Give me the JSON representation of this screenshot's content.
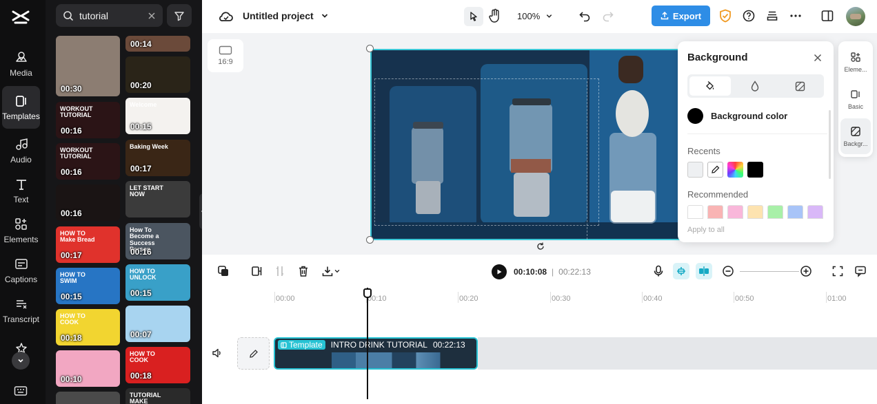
{
  "sidebar": {
    "items": [
      {
        "label": "Media",
        "icon": "media-icon"
      },
      {
        "label": "Templates",
        "icon": "templates-icon"
      },
      {
        "label": "Audio",
        "icon": "audio-icon"
      },
      {
        "label": "Text",
        "icon": "text-icon"
      },
      {
        "label": "Elements",
        "icon": "elements-icon"
      },
      {
        "label": "Captions",
        "icon": "captions-icon"
      },
      {
        "label": "Transcript",
        "icon": "transcript-icon"
      },
      {
        "label": "",
        "icon": "effects-icon"
      }
    ]
  },
  "search": {
    "value": "tutorial"
  },
  "templates": [
    {
      "duration": "00:30",
      "caption": "",
      "color": "#8c7d72"
    },
    {
      "duration": "00:14",
      "caption": "",
      "color": "#6b4a3a"
    },
    {
      "duration": "00:20",
      "caption": "",
      "color": "#2a2418"
    },
    {
      "duration": "00:16",
      "caption": "WORKOUT TUTORIAL",
      "color": "#2b1416"
    },
    {
      "duration": "00:15",
      "caption": "Welcome",
      "color": "#f4f2ef"
    },
    {
      "duration": "00:16",
      "caption": "WORKOUT TUTORIAL",
      "color": "#2b1416"
    },
    {
      "duration": "00:17",
      "caption": "Baking Week",
      "color": "#3a2616"
    },
    {
      "duration": "00:16",
      "caption": "",
      "color": "#1a1414"
    },
    {
      "duration": "",
      "caption": "LET START NOW",
      "color": "#3b3b3b"
    },
    {
      "duration": "00:17",
      "caption": "HOW TO Make Bread",
      "color": "#e0322c"
    },
    {
      "duration": "00:16",
      "caption": "How To Become a Success Person",
      "color": "#4b5560"
    },
    {
      "duration": "00:15",
      "caption": "HOW TO SWIM",
      "color": "#2775c4"
    },
    {
      "duration": "00:15",
      "caption": "HOW TO UNLOCK",
      "color": "#39a0c8"
    },
    {
      "duration": "00:18",
      "caption": "HOW TO COOK",
      "color": "#f2d530"
    },
    {
      "duration": "00:07",
      "caption": "",
      "color": "#a8d4f0"
    },
    {
      "duration": "00:10",
      "caption": "",
      "color": "#f2a7c2"
    },
    {
      "duration": "00:18",
      "caption": "HOW TO COOK",
      "color": "#d92020"
    },
    {
      "duration": "",
      "caption": "",
      "color": "#4a4a4a"
    },
    {
      "duration": "",
      "caption": "TUTORIAL MAKE",
      "color": "#2a2a2a"
    }
  ],
  "header": {
    "project_title": "Untitled project",
    "zoom": "100%",
    "export_label": "Export"
  },
  "canvas": {
    "ratio_label": "16:9"
  },
  "background_panel": {
    "title": "Background",
    "color_label": "Background color",
    "recents_label": "Recents",
    "recommended_label": "Recommended",
    "apply_label": "Apply to all",
    "current_color": "#000000",
    "recent_colors": [
      "#e8ebee",
      "eyedropper",
      "gradient",
      "#000000"
    ],
    "recommended_colors": [
      "#ffffff",
      "#f9b4b4",
      "#f9b7da",
      "#fde3b0",
      "#a8f0a8",
      "#a8c4f8",
      "#d9b8f8"
    ]
  },
  "right_panel": {
    "items": [
      {
        "label": "Eleme...",
        "icon": "elements-icon"
      },
      {
        "label": "Basic",
        "icon": "basic-icon"
      },
      {
        "label": "Backgr...",
        "icon": "background-icon"
      }
    ]
  },
  "playback": {
    "current_time": "00:10:08",
    "separator": "|",
    "total_time": "00:22:13"
  },
  "timeline": {
    "ticks": [
      "00:00",
      "00:10",
      "00:20",
      "00:30",
      "00:40",
      "00:50",
      "01:00"
    ],
    "clip": {
      "badge": "Template",
      "name": "INTRO DRINK TUTORIAL",
      "duration": "00:22:13"
    }
  },
  "colors": {
    "accent": "#2e8de6",
    "selection": "#3bc7d6",
    "sidebar_bg": "#0f0f10",
    "panel_bg": "#161618"
  }
}
